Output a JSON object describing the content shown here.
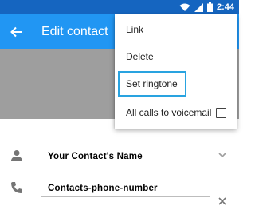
{
  "status_bar": {
    "time": "2:44",
    "color": "#1565c0"
  },
  "app_bar": {
    "title": "Edit contact",
    "color": "#2196f3",
    "back_icon": "arrow-back-icon"
  },
  "menu": {
    "items": [
      {
        "label": "Link"
      },
      {
        "label": "Delete"
      },
      {
        "label": "Set ringtone",
        "highlighted": true
      },
      {
        "label": "All calls to voicemail",
        "checkbox": true,
        "checked": false
      }
    ],
    "highlight_color": "#29a3e0"
  },
  "contact": {
    "name": "Your Contact's Name",
    "phone": "Contacts-phone-number"
  }
}
